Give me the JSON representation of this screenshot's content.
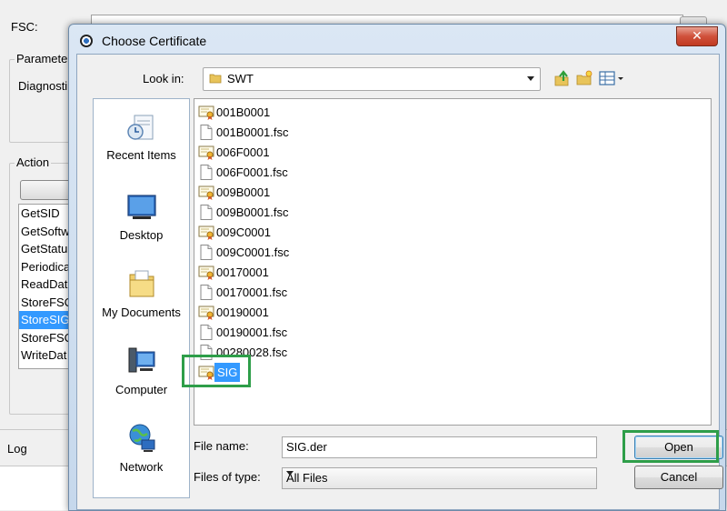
{
  "background_window": {
    "fsc_label": "FSC:",
    "parameters_group_label": "Paramete",
    "diagnostics_label": "Diagnosti",
    "action_group_label": "Action",
    "action_items": [
      {
        "label": "GetSID",
        "selected": false
      },
      {
        "label": "GetSoftw",
        "selected": false
      },
      {
        "label": "GetStatu",
        "selected": false
      },
      {
        "label": "Periodica",
        "selected": false
      },
      {
        "label": "ReadDat",
        "selected": false
      },
      {
        "label": "StoreFSC",
        "selected": false
      },
      {
        "label": "StoreSIG",
        "selected": true
      },
      {
        "label": "StoreFSC",
        "selected": false
      },
      {
        "label": "WriteDat",
        "selected": false
      }
    ],
    "log_label": "Log"
  },
  "dialog": {
    "title": "Choose Certificate",
    "close_glyph": "✕",
    "look_in_label": "Look in:",
    "look_in_value": "SWT",
    "places": [
      {
        "label": "Recent Items",
        "icon": "recent-items-icon"
      },
      {
        "label": "Desktop",
        "icon": "desktop-icon"
      },
      {
        "label": "My Documents",
        "icon": "my-documents-icon"
      },
      {
        "label": "Computer",
        "icon": "computer-icon"
      },
      {
        "label": "Network",
        "icon": "network-icon"
      }
    ],
    "files": [
      {
        "name": "001B0001",
        "type": "certificate"
      },
      {
        "name": "001B0001.fsc",
        "type": "file"
      },
      {
        "name": "006F0001",
        "type": "certificate"
      },
      {
        "name": "006F0001.fsc",
        "type": "file"
      },
      {
        "name": "009B0001",
        "type": "certificate"
      },
      {
        "name": "009B0001.fsc",
        "type": "file"
      },
      {
        "name": "009C0001",
        "type": "certificate"
      },
      {
        "name": "009C0001.fsc",
        "type": "file"
      },
      {
        "name": "00170001",
        "type": "certificate"
      },
      {
        "name": "00170001.fsc",
        "type": "file"
      },
      {
        "name": "00190001",
        "type": "certificate"
      },
      {
        "name": "00190001.fsc",
        "type": "file"
      },
      {
        "name": "00280028.fsc",
        "type": "file"
      },
      {
        "name": "SIG",
        "type": "certificate",
        "selected": true
      }
    ],
    "file_name_label": "File name:",
    "file_name_value": "SIG.der",
    "file_type_label": "Files of type:",
    "file_type_value": "All Files",
    "open_label": "Open",
    "cancel_label": "Cancel",
    "highlight_color": "#2e9e49",
    "selection_color": "#3399ff"
  }
}
